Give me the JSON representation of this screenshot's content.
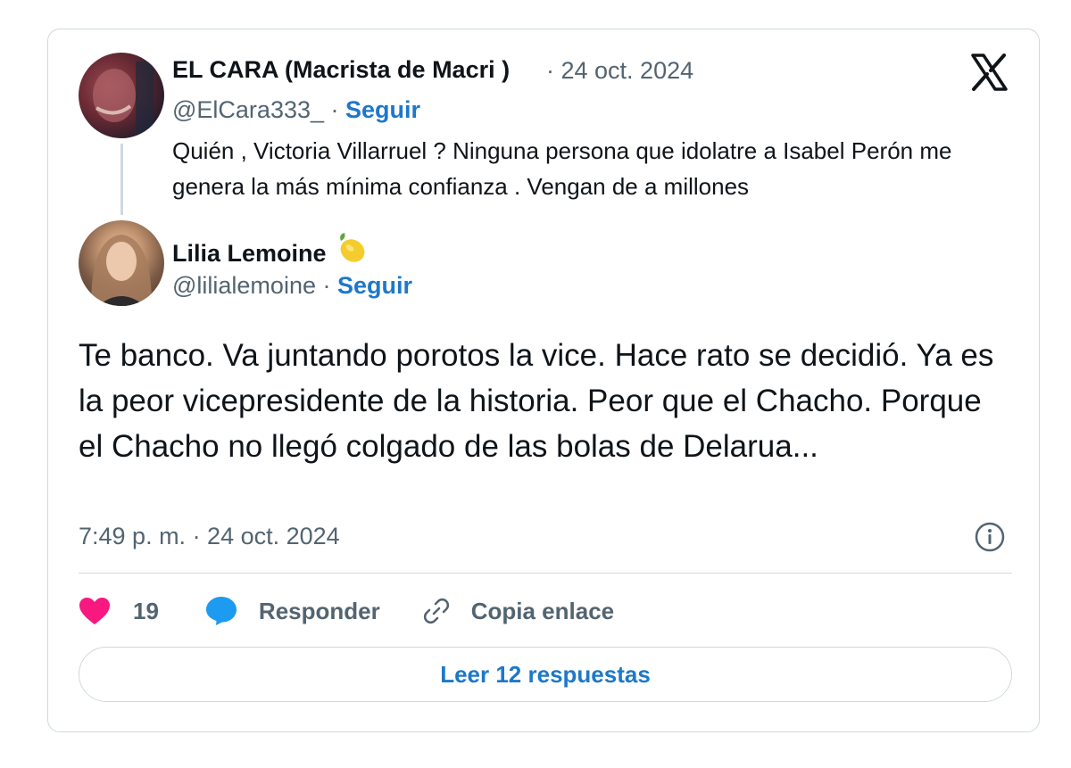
{
  "quoted_tweet": {
    "author_name": "EL CARA (Macrista de Macri )",
    "date": "· 24 oct. 2024",
    "handle": "@ElCara333_ ·",
    "follow_label": "Seguir",
    "text": "Quién , Victoria Villarruel ? Ninguna persona que idolatre a Isabel Perón me genera la más mínima confianza . Vengan de a millones"
  },
  "reply_tweet": {
    "author_name": "Lilia Lemoine",
    "emoji": "lemon-icon",
    "handle": "@lilialemoine ·",
    "follow_label": "Seguir",
    "text": "Te banco. Va juntando porotos la vice. Hace rato se decidió. Ya es la peor vicepresidente de la historia. Peor que el Chacho. Porque el Chacho no llegó colgado de las bolas de Delarua...",
    "timestamp": "7:49 p. m. · 24 oct. 2024"
  },
  "actions": {
    "like_count": "19",
    "reply_label": "Responder",
    "copy_link_label": "Copia enlace",
    "read_replies_label": "Leer 12 respuestas"
  },
  "colors": {
    "like": "#f91880",
    "reply": "#1d9bf0",
    "link": "#1d78c9",
    "border": "#cfd9de",
    "muted_text": "#536471"
  },
  "icons": [
    "x-logo-icon",
    "heart-icon",
    "speech-bubble-icon",
    "link-icon",
    "info-icon",
    "lemon-icon"
  ]
}
